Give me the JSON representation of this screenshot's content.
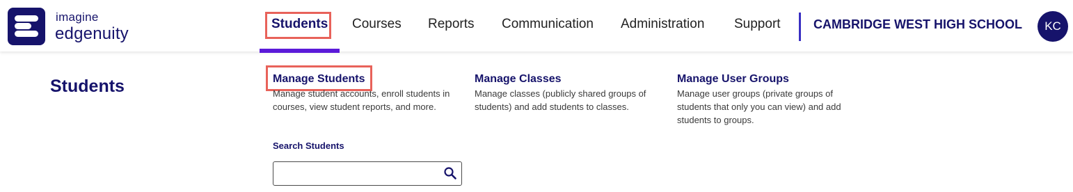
{
  "logo": {
    "line1": "imagine",
    "line2": "edgenuity"
  },
  "nav": {
    "items": [
      {
        "label": "Students",
        "active": true
      },
      {
        "label": "Courses"
      },
      {
        "label": "Reports"
      },
      {
        "label": "Communication"
      },
      {
        "label": "Administration"
      },
      {
        "label": "Support"
      }
    ],
    "school": "CAMBRIDGE WEST HIGH SCHOOL",
    "avatar_initials": "KC"
  },
  "menu": {
    "title": "Students",
    "columns": [
      {
        "link": "Manage Students",
        "description": "Manage student accounts, enroll students in courses, view student reports, and more."
      },
      {
        "link": "Manage Classes",
        "description": "Manage classes (publicly shared groups of students) and add students to classes."
      },
      {
        "link": "Manage User Groups",
        "description": "Manage user groups (private groups of students that only you can view) and add students to groups."
      }
    ],
    "search": {
      "label": "Search Students",
      "value": "",
      "icon": "search-icon"
    }
  },
  "colors": {
    "brand_navy": "#16136b",
    "active_underline": "#5b1ad9",
    "highlight_box": "#e8625a"
  }
}
